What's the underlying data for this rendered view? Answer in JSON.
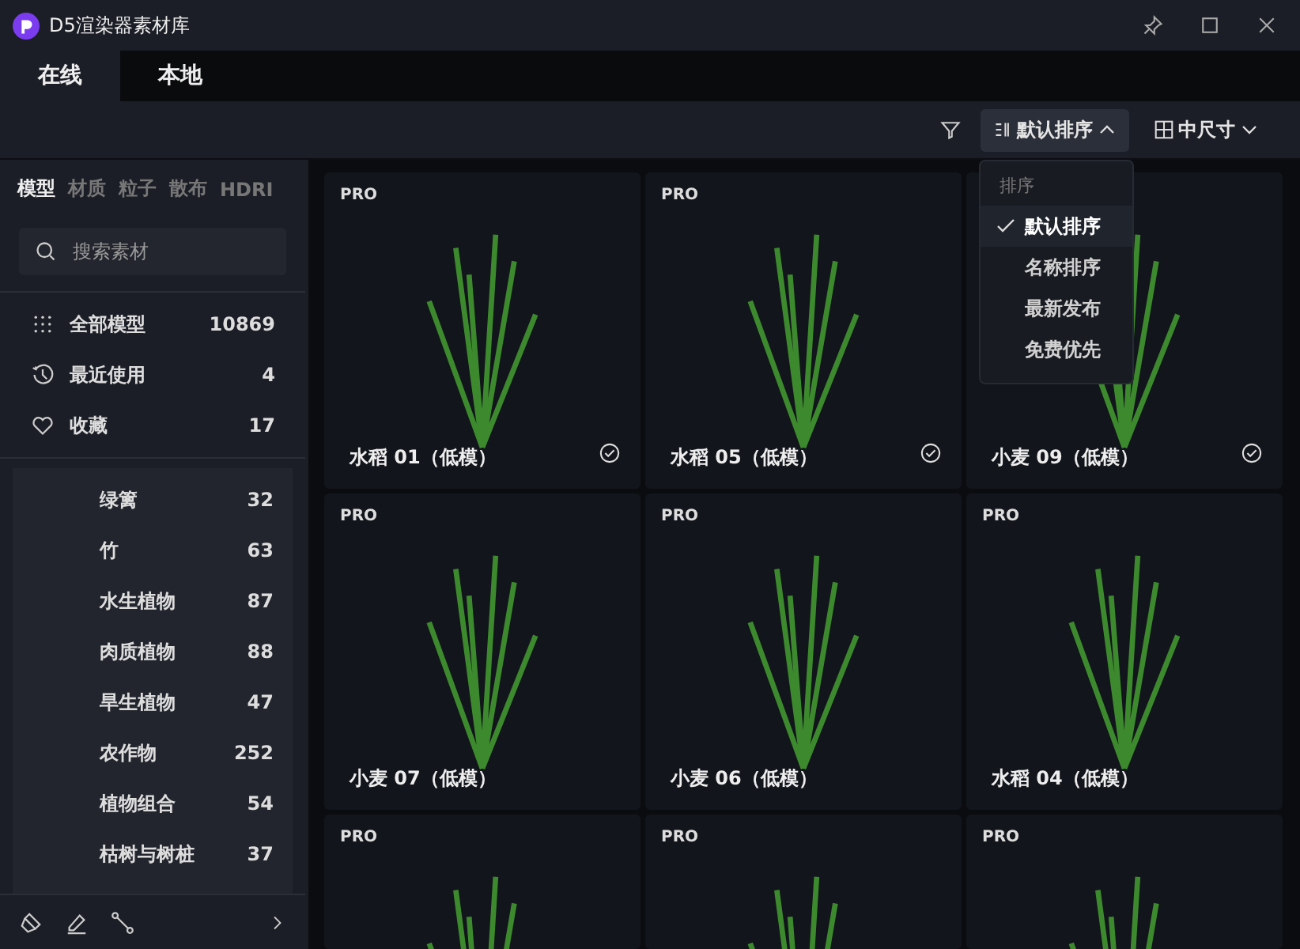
{
  "window": {
    "title": "D5渲染器素材库"
  },
  "tabs": [
    {
      "label": "在线",
      "selected": true
    },
    {
      "label": "本地",
      "selected": false
    }
  ],
  "toolbar": {
    "sort_label": "默认排序",
    "size_label": "中尺寸",
    "sort_menu_open": true
  },
  "sort_menu": {
    "heading": "排序",
    "items": [
      {
        "label": "默认排序",
        "selected": true
      },
      {
        "label": "名称排序",
        "selected": false
      },
      {
        "label": "最新发布",
        "selected": false
      },
      {
        "label": "免费优先",
        "selected": false
      }
    ]
  },
  "asset_types": [
    {
      "label": "模型",
      "selected": true
    },
    {
      "label": "材质",
      "selected": false
    },
    {
      "label": "粒子",
      "selected": false
    },
    {
      "label": "散布",
      "selected": false
    },
    {
      "label": "HDRI",
      "selected": false
    }
  ],
  "search": {
    "placeholder": "搜索素材"
  },
  "quick_links": [
    {
      "kind": "all",
      "label": "全部模型",
      "count": "10869"
    },
    {
      "kind": "recent",
      "label": "最近使用",
      "count": "4"
    },
    {
      "kind": "favorite",
      "label": "收藏",
      "count": "17"
    }
  ],
  "categories": [
    {
      "label": "绿篱",
      "count": "32"
    },
    {
      "label": "竹",
      "count": "63"
    },
    {
      "label": "水生植物",
      "count": "87"
    },
    {
      "label": "肉质植物",
      "count": "88"
    },
    {
      "label": "旱生植物",
      "count": "47"
    },
    {
      "label": "农作物",
      "count": "252"
    },
    {
      "label": "植物组合",
      "count": "54"
    },
    {
      "label": "枯树与树桩",
      "count": "37"
    }
  ],
  "assets": [
    {
      "badge": "PRO",
      "name": "水稻 01（低模）",
      "downloaded": true
    },
    {
      "badge": "PRO",
      "name": "水稻 05（低模）",
      "downloaded": true
    },
    {
      "name": "小麦 09（低模）",
      "downloaded": true
    },
    {
      "badge": "PRO",
      "name": "小麦 07（低模）",
      "downloaded": false
    },
    {
      "badge": "PRO",
      "name": "小麦 06（低模）",
      "downloaded": false
    },
    {
      "badge": "PRO",
      "name": "水稻 04（低模）",
      "downloaded": false
    },
    {
      "badge": "PRO"
    },
    {
      "badge": "PRO"
    },
    {
      "badge": "PRO"
    }
  ]
}
